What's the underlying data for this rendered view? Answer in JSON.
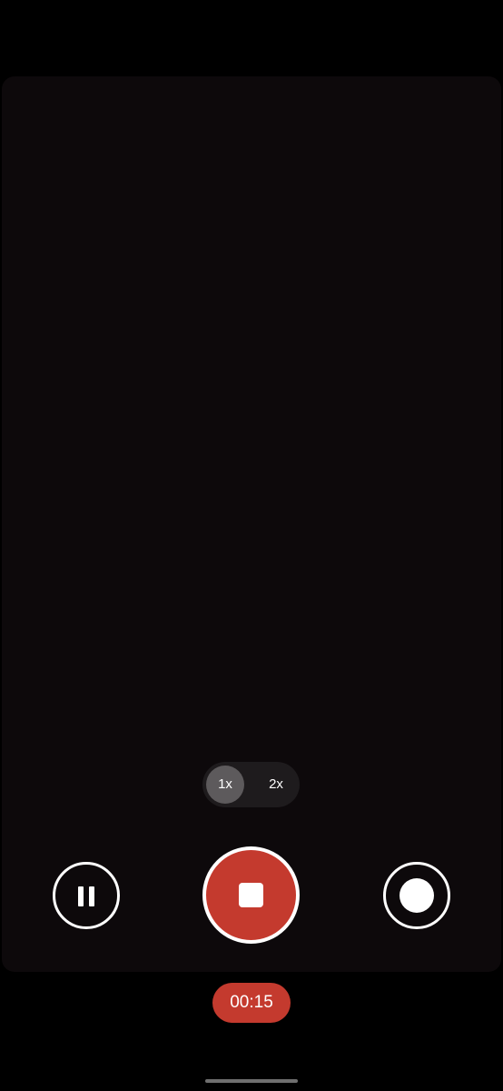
{
  "zoom": {
    "options": [
      "1x",
      "2x"
    ],
    "selected": "1x"
  },
  "controls": {
    "pause_icon": "pause-icon",
    "stop_icon": "stop-icon",
    "snapshot_icon": "capture-photo-icon"
  },
  "recording": {
    "elapsed": "00:15",
    "state": "recording"
  },
  "colors": {
    "record_red": "#c43a2e",
    "viewfinder_bg": "#0d090b",
    "zoom_pill_bg": "#1e1b1d",
    "zoom_selected_bg": "#5d5a5c"
  }
}
